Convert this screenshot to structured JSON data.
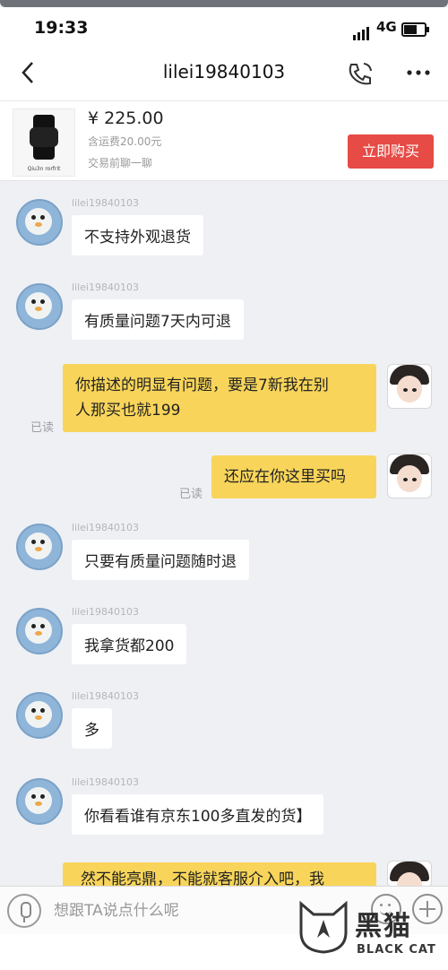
{
  "status_bar": {
    "time": "19:33",
    "network": "4G"
  },
  "header": {
    "title": "lilei19840103"
  },
  "product": {
    "price": "¥ 225.00",
    "shipping": "含运费20.00元",
    "chat_hint": "交易前聊一聊",
    "buy_label": "立即购买",
    "image_caption": "Qiu3n rorfrit"
  },
  "messages": [
    {
      "side": "left",
      "sender": "lilei19840103",
      "text": "不支持外观退货"
    },
    {
      "side": "left",
      "sender": "lilei19840103",
      "text": "有质量问题7天内可退"
    },
    {
      "side": "right",
      "status": "已读",
      "line1": "你描述的明显有问题，要是7新我在别",
      "line2": "人那买也就199"
    },
    {
      "side": "right",
      "status": "已读",
      "text": "还应在你这里买吗"
    },
    {
      "side": "left",
      "sender": "lilei19840103",
      "text": "只要有质量问题随时退"
    },
    {
      "side": "left",
      "sender": "lilei19840103",
      "text": "我拿货都200"
    },
    {
      "side": "left",
      "sender": "lilei19840103",
      "text": "多"
    },
    {
      "side": "left",
      "sender": "lilei19840103",
      "text": "你看看谁有京东100多直发的货】"
    },
    {
      "side": "right",
      "text": "然不能亮鼎，不能就客服介入吧，我"
    }
  ],
  "input": {
    "placeholder": "想跟TA说点什么呢"
  },
  "watermark": {
    "cn": "黑猫",
    "en": "BLACK CAT"
  },
  "colors": {
    "buy_button": "#e64b45",
    "my_bubble": "#f8d55a",
    "background": "#eef0f4"
  }
}
